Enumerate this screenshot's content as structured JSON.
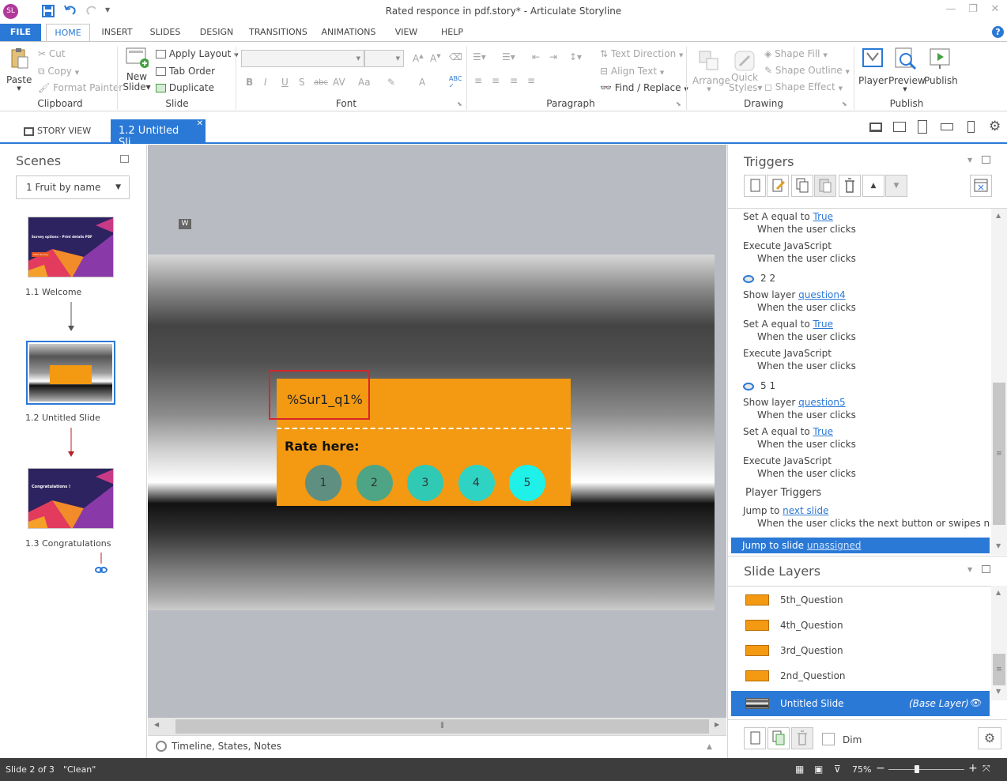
{
  "app": {
    "title": "Rated responce in pdf.story* - Articulate Storyline",
    "avatar_initials": "SL"
  },
  "ribbon_tabs": [
    "FILE",
    "HOME",
    "INSERT",
    "SLIDES",
    "DESIGN",
    "TRANSITIONS",
    "ANIMATIONS",
    "VIEW",
    "HELP"
  ],
  "clipboard": {
    "paste": "Paste",
    "cut": "Cut",
    "copy": "Copy",
    "format_painter": "Format Painter",
    "group": "Clipboard"
  },
  "slide_group": {
    "new_slide": "New\nSlide",
    "apply_layout": "Apply Layout",
    "tab_order": "Tab Order",
    "duplicate": "Duplicate",
    "group": "Slide"
  },
  "font_group": {
    "group": "Font",
    "bold": "B",
    "italic": "I",
    "underline": "U",
    "strike": "S",
    "abc": "abc",
    "av": "AV",
    "aa": "Aa",
    "a": "A"
  },
  "paragraph_group": {
    "text_direction": "Text Direction",
    "align_text": "Align Text",
    "find_replace": "Find / Replace",
    "group": "Paragraph"
  },
  "drawing_group": {
    "arrange": "Arrange",
    "quick_styles": "Quick\nStyles",
    "shape_fill": "Shape Fill",
    "shape_outline": "Shape Outline",
    "shape_effect": "Shape Effect",
    "group": "Drawing"
  },
  "publish_group": {
    "player": "Player",
    "preview": "Preview",
    "publish": "Publish",
    "group": "Publish"
  },
  "view_tabs": {
    "story_view": "STORY VIEW",
    "current_slide": "1.2 Untitled Sli..."
  },
  "scenes": {
    "title": "Scenes",
    "dropdown": "1 Fruit by name",
    "slides": [
      {
        "label": "1.1 Welcome",
        "title": "Survey options – Print details PDF",
        "btn": "Start Survey"
      },
      {
        "label": "1.2 Untitled Slide"
      },
      {
        "label": "1.3 Congratulations",
        "title": "Congratulations !"
      }
    ]
  },
  "canvas": {
    "marker": "W",
    "variable_text": "%Sur1_q1%",
    "rate_label": "Rate here:",
    "rate_buttons": [
      "1",
      "2",
      "3",
      "4",
      "5"
    ],
    "rate_colors": [
      "#5e8f80",
      "#4ea586",
      "#2fc9b4",
      "#2ed3c4",
      "#1ff0e8"
    ],
    "timeline_label": "Timeline, States, Notes"
  },
  "triggers": {
    "title": "Triggers",
    "items": [
      {
        "action": "Set A equal to ",
        "link": "True",
        "cond": "When the user clicks"
      },
      {
        "action": "Execute JavaScript",
        "link": "",
        "cond": "When the user clicks"
      },
      {
        "object": "2 2"
      },
      {
        "action": "Show layer ",
        "link": "question4",
        "cond": "When the user clicks"
      },
      {
        "action": "Set A equal to ",
        "link": "True",
        "cond": "When the user clicks"
      },
      {
        "action": "Execute JavaScript",
        "link": "",
        "cond": "When the user clicks"
      },
      {
        "object": "5 1"
      },
      {
        "action": "Show layer ",
        "link": "question5",
        "cond": "When the user clicks"
      },
      {
        "action": "Set A equal to ",
        "link": "True",
        "cond": "When the user clicks"
      },
      {
        "action": "Execute JavaScript",
        "link": "",
        "cond": "When the user clicks"
      }
    ],
    "player_triggers_label": "Player Triggers",
    "player": {
      "action": "Jump to ",
      "link": "next slide",
      "cond": "When the user clicks the next button or swipes next"
    },
    "selected": {
      "action": "Jump to slide ",
      "link": "unassigned"
    }
  },
  "layers": {
    "title": "Slide Layers",
    "items": [
      "5th_Question",
      "4th_Question",
      "3rd_Question",
      "2nd_Question"
    ],
    "base": {
      "name": "Untitled Slide",
      "tag": "(Base Layer)"
    },
    "dim": "Dim"
  },
  "status": {
    "slide": "Slide 2 of 3",
    "theme": "\"Clean\"",
    "zoom": "75%"
  },
  "colors": {
    "accent": "#2b79d6",
    "card": "#f39912",
    "highlight": "#d9242b"
  }
}
